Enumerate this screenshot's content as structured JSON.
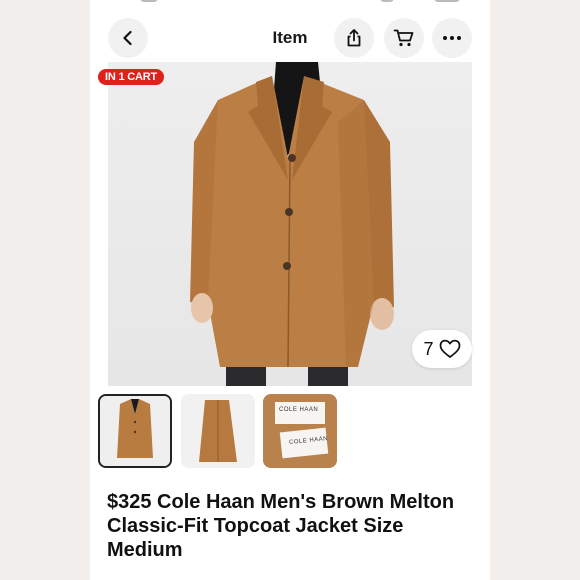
{
  "nav": {
    "title": "Item",
    "back_icon": "chevron-left-icon",
    "share_icon": "share-icon",
    "cart_icon": "cart-icon",
    "more_icon": "more-horizontal-icon"
  },
  "hero": {
    "badge": "IN 1 CART",
    "likes": "7",
    "badge_color": "#e0211b"
  },
  "thumbnails": [
    {
      "label": "coat front"
    },
    {
      "label": "coat side"
    },
    {
      "label": "cole haan label"
    }
  ],
  "labels": {
    "brand_top": "COLE HAAN",
    "brand_bottom": "COLE HAAN"
  },
  "listing": {
    "title": "$325 Cole Haan Men's Brown Melton Classic-Fit Topcoat Jacket Size Medium"
  }
}
